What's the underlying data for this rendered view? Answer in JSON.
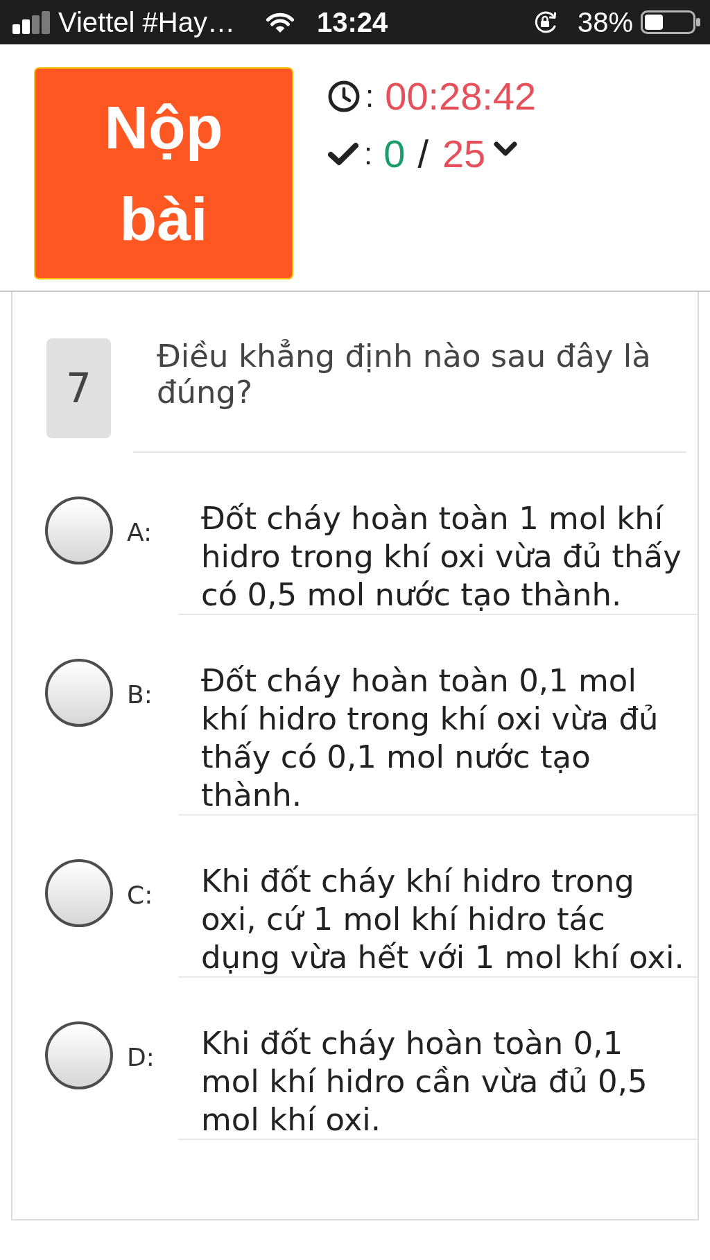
{
  "status_bar": {
    "carrier": "Viettel #Hay…",
    "time": "13:24",
    "battery": "38%"
  },
  "header": {
    "submit_button": "Nộp bài",
    "timer": {
      "separator": ":",
      "value": "00:28:42"
    },
    "progress": {
      "separator": ":",
      "answered": "0",
      "slash": "/",
      "total": "25"
    }
  },
  "question": {
    "number": "7",
    "text": "Điều khẳng định nào sau đây là đúng?",
    "options": [
      {
        "letter": "A:",
        "text": "Đốt cháy hoàn toàn 1 mol khí hidro trong khí oxi vừa đủ thấy có 0,5 mol nước tạo thành.",
        "selected": false
      },
      {
        "letter": "B:",
        "text": "Đốt cháy hoàn toàn 0,1 mol khí hidro trong khí oxi vừa đủ thấy có 0,1 mol nước tạo thành.",
        "selected": false
      },
      {
        "letter": "C:",
        "text": "Khi đốt cháy khí hidro trong oxi, cứ 1 mol khí hidro tác dụng vừa hết với 1 mol khí oxi.",
        "selected": false
      },
      {
        "letter": "D:",
        "text": "Khi đốt cháy hoàn toàn 0,1 mol khí hidro cần vừa đủ 0,5 mol khí oxi.",
        "selected": false
      }
    ]
  }
}
